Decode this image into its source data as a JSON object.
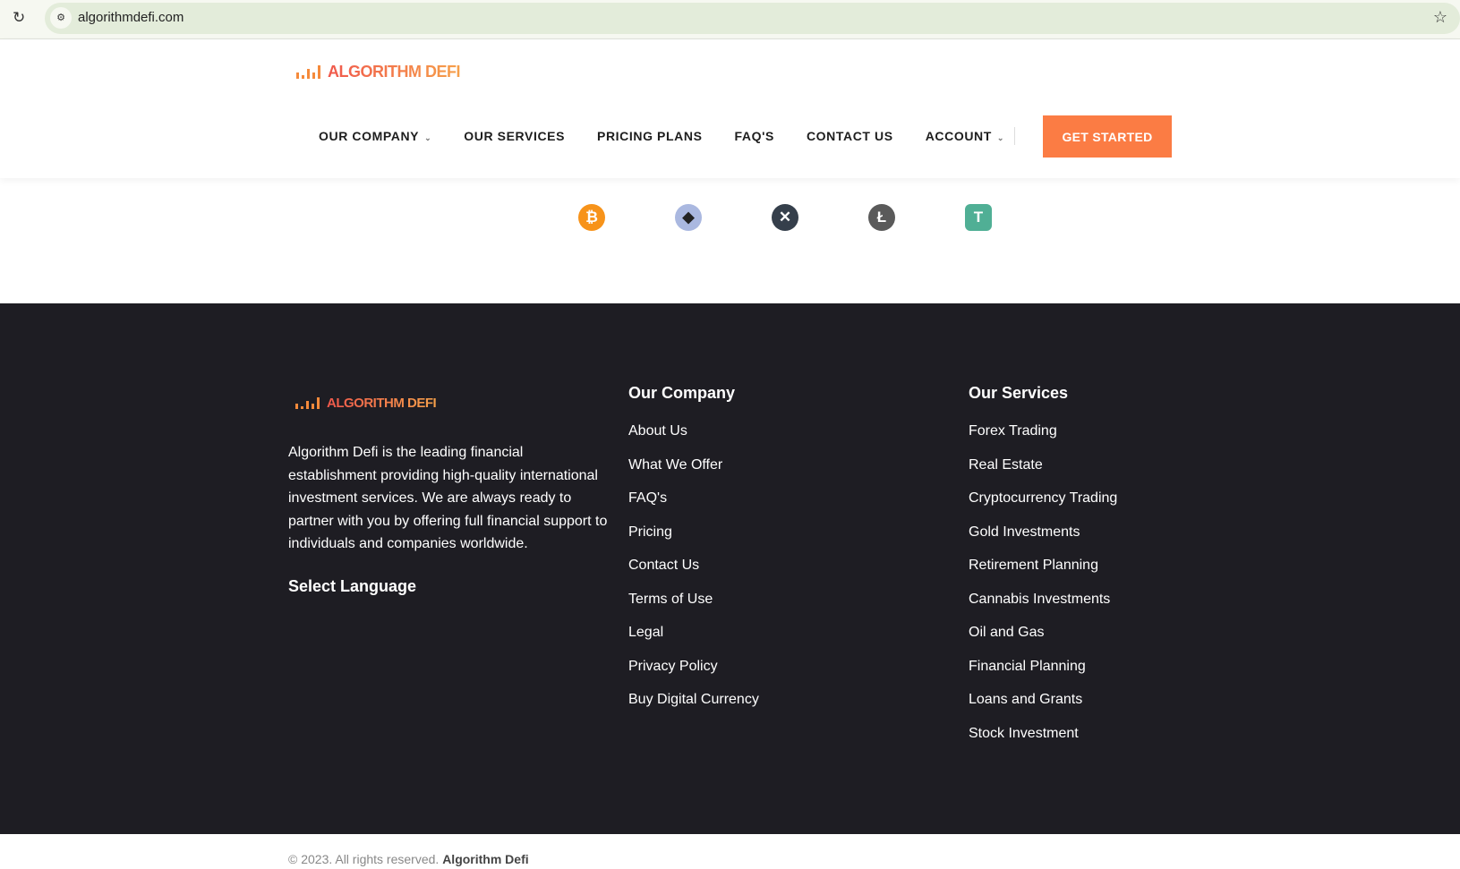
{
  "browser": {
    "url": "algorithmdefi.com"
  },
  "brand": {
    "logo_text": "ALGORITHM DEFI",
    "accent": "#fb7c44"
  },
  "nav": {
    "items": [
      "OUR COMPANY",
      "OUR SERVICES",
      "PRICING PLANS",
      "FAQ'S",
      "CONTACT US",
      "ACCOUNT"
    ],
    "cta": "GET STARTED"
  },
  "coins": [
    {
      "name": "bitcoin",
      "glyph": "₿",
      "color": "#f7931a"
    },
    {
      "name": "ethereum",
      "glyph": "◆",
      "color": "#aab8e0"
    },
    {
      "name": "xrp",
      "glyph": "✕",
      "color": "#353f4b"
    },
    {
      "name": "litecoin",
      "glyph": "Ł",
      "color": "#5a5a5a"
    },
    {
      "name": "tether",
      "glyph": "T",
      "color": "#50af95"
    }
  ],
  "footer": {
    "about": "Algorithm Defi is the leading financial establishment providing high-quality international investment services. We are always ready to partner with you by offering full financial support to individuals and companies worldwide.",
    "language_title": "Select Language",
    "company": {
      "title": "Our Company",
      "links": [
        "About Us",
        "What We Offer",
        "FAQ's",
        "Pricing",
        "Contact Us",
        "Terms of Use",
        "Legal",
        "Privacy Policy",
        "Buy Digital Currency"
      ]
    },
    "services": {
      "title": "Our Services",
      "links": [
        "Forex Trading",
        "Real Estate",
        "Cryptocurrency Trading",
        "Gold Investments",
        "Retirement Planning",
        "Cannabis Investments",
        "Oil and Gas",
        "Financial Planning",
        "Loans and Grants",
        "Stock Investment"
      ]
    },
    "copyright": "© 2023. All rights reserved.",
    "copyright_brand": "Algorithm Defi"
  }
}
